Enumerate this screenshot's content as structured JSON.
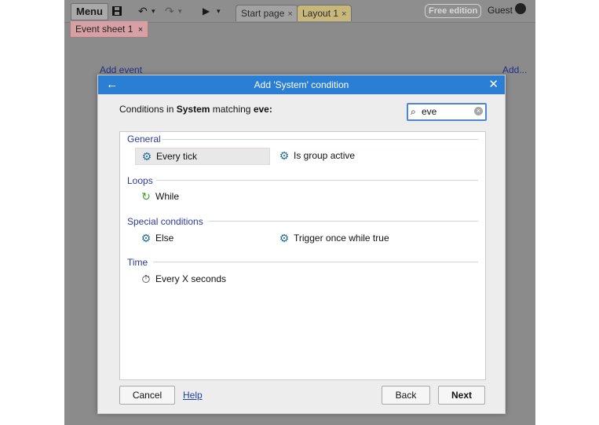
{
  "toolbar": {
    "menu_label": "Menu",
    "tabs": [
      {
        "label": "Start page",
        "close": "×"
      },
      {
        "label": "Layout 1",
        "close": "×"
      }
    ],
    "edition_badge": "Free edition",
    "user_label": "Guest"
  },
  "sheet_tab": {
    "label": "Event sheet 1",
    "close": "×"
  },
  "event_sheet": {
    "add_event": "Add event",
    "add_more": "Add..."
  },
  "dialog": {
    "title": "Add 'System' condition",
    "subtitle_prefix": "Conditions in",
    "subtitle_object": "System",
    "subtitle_mid": "matching",
    "subtitle_term": "eve:",
    "search": {
      "value": "eve"
    },
    "sections": [
      {
        "label": "General",
        "items": [
          {
            "label": "Every tick",
            "icon": "gear-icon",
            "selected": true
          },
          {
            "label": "Is group active",
            "icon": "gear-icon"
          }
        ]
      },
      {
        "label": "Loops",
        "items": [
          {
            "label": "While",
            "icon": "loop-icon"
          }
        ]
      },
      {
        "label": "Special conditions",
        "items": [
          {
            "label": "Else",
            "icon": "gear-icon"
          },
          {
            "label": "Trigger once while true",
            "icon": "gear-icon"
          }
        ]
      },
      {
        "label": "Time",
        "items": [
          {
            "label": "Every X seconds",
            "icon": "stopwatch-icon"
          }
        ]
      }
    ],
    "buttons": {
      "cancel": "Cancel",
      "help": "Help",
      "back": "Back",
      "next": "Next"
    }
  }
}
